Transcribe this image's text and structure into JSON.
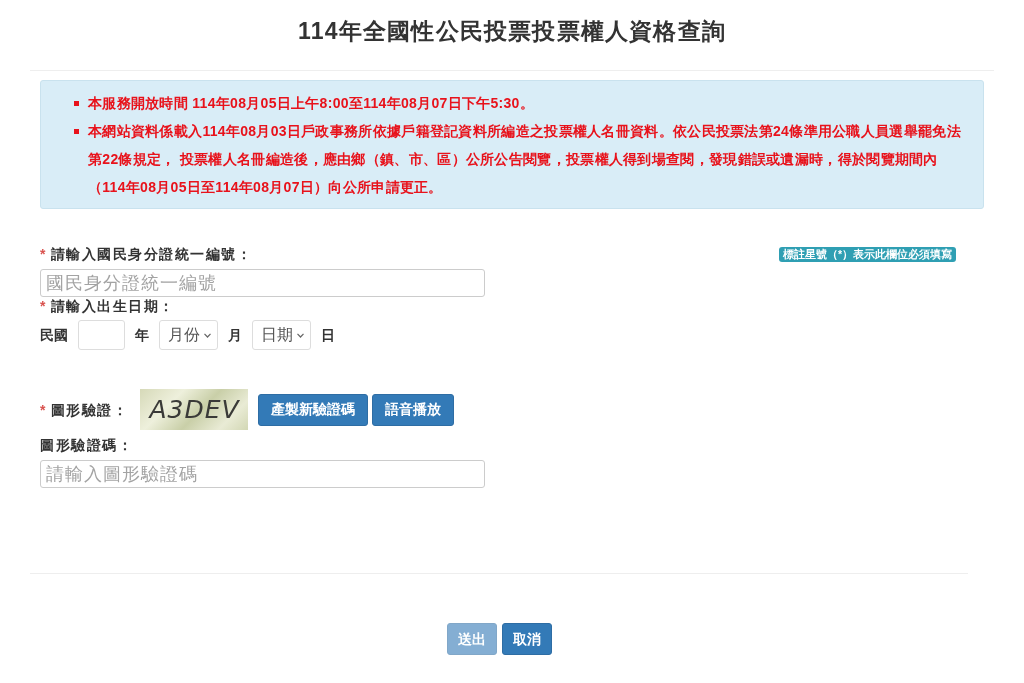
{
  "page_title": "114年全國性公民投票投票權人資格查詢",
  "notice": {
    "items": [
      "本服務開放時間 114年08月05日上午8:00至114年08月07日下午5:30。",
      "本網站資料係載入114年08月03日戶政事務所依據戶籍登記資料所編造之投票權人名冊資料。依公民投票法第24條準用公職人員選舉罷免法第22條規定， 投票權人名冊編造後，應由鄉（鎮、市、區）公所公告閱覽，投票權人得到場查閱，發現錯誤或遺漏時，得於閱覽期間內（114年08月05日至114年08月07日）向公所申請更正。"
    ]
  },
  "required_note": "標註星號（*）表示此欄位必須填寫",
  "id_field": {
    "marker": "*",
    "label": "請輸入國民身分證統一編號：",
    "placeholder": "國民身分證統一編號"
  },
  "birth_date": {
    "marker": "*",
    "label": "請輸入出生日期：",
    "era": "民國",
    "year_unit": "年",
    "month_select": "月份",
    "month_unit": "月",
    "day_select": "日期",
    "day_unit": "日"
  },
  "captcha": {
    "marker": "*",
    "label": "圖形驗證：",
    "image_text": "A3DEV",
    "buttons": [
      "產製新驗證碼",
      "語音播放"
    ]
  },
  "captcha_field": {
    "label": "圖形驗證碼：",
    "placeholder": "請輸入圖形驗證碼"
  },
  "actions": [
    {
      "label": "送出",
      "disabled": true
    },
    {
      "label": "取消",
      "disabled": false
    }
  ]
}
